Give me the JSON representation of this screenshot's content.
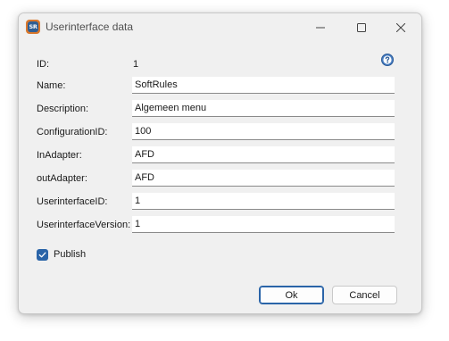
{
  "window": {
    "title": "Userinterface data",
    "icon_text": "SR"
  },
  "fields": {
    "id": {
      "label": "ID:",
      "value": "1"
    },
    "name": {
      "label": "Name:",
      "value": "SoftRules"
    },
    "description": {
      "label": "Description:",
      "value": "Algemeen menu"
    },
    "configuration_id": {
      "label": "ConfigurationID:",
      "value": "100"
    },
    "in_adapter": {
      "label": "InAdapter:",
      "value": "AFD"
    },
    "out_adapter": {
      "label": "outAdapter:",
      "value": "AFD"
    },
    "userinterface_id": {
      "label": "UserinterfaceID:",
      "value": "1"
    },
    "userinterface_version": {
      "label": "UserinterfaceVersion:",
      "value": "1"
    }
  },
  "publish": {
    "label": "Publish",
    "checked": true
  },
  "buttons": {
    "ok": "Ok",
    "cancel": "Cancel"
  },
  "icons": {
    "app": "softrules-app-icon",
    "help": "help-icon",
    "minimize": "minimize-icon",
    "maximize": "maximize-icon",
    "close": "close-icon",
    "check": "checkmark-icon"
  },
  "colors": {
    "accent": "#2a64a8",
    "window_bg": "#f0f0f0",
    "app_icon_orange": "#d9772c",
    "app_icon_blue": "#2f5e93"
  }
}
